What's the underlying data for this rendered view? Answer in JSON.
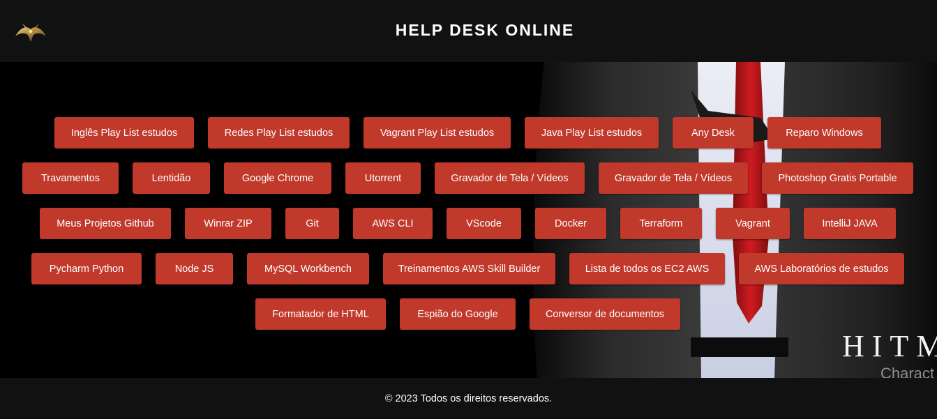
{
  "header": {
    "title": "HELP DESK ONLINE",
    "logo_icon": "gold-ornament-logo"
  },
  "hero": {
    "background_brand": "HITM",
    "background_brand_sub": "Charact"
  },
  "links": [
    [
      "Inglês Play List estudos",
      "Redes Play List estudos",
      "Vagrant Play List estudos",
      "Java Play List estudos",
      "Any Desk",
      "Reparo Windows"
    ],
    [
      "Travamentos",
      "Lentidão",
      "Google Chrome",
      "Utorrent",
      "Gravador de Tela / Vídeos",
      "Gravador de Tela / Vídeos",
      "Photoshop Gratis Portable"
    ],
    [
      "Meus Projetos Github",
      "Winrar ZIP",
      "Git",
      "AWS CLI",
      "VScode",
      "Docker",
      "Terraform",
      "Vagrant",
      "IntelliJ JAVA"
    ],
    [
      "Pycharm Python",
      "Node JS",
      "MySQL Workbench",
      "Treinamentos AWS Skill Builder",
      "Lista de todos os EC2 AWS",
      "AWS Laboratórios de estudos"
    ],
    [
      "Formatador de HTML",
      "Espião do Google",
      "Conversor de documentos"
    ]
  ],
  "footer": {
    "copyright": "© 2023 Todos os direitos reservados."
  },
  "colors": {
    "button": "#c0392b",
    "bar": "#111111",
    "background": "#000000"
  }
}
